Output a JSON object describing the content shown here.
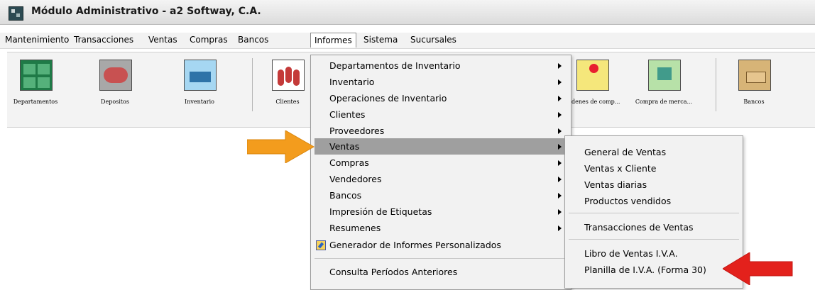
{
  "window": {
    "title": "Módulo Administrativo - a2 Softway, C.A."
  },
  "menubar": {
    "items": [
      "Mantenimiento",
      "Transacciones",
      "Ventas",
      "Compras",
      "Bancos",
      "Informes",
      "Sistema",
      "Sucursales"
    ],
    "active": "Informes"
  },
  "toolbar": {
    "buttons": [
      {
        "label": "Departamentos",
        "icon": "departments-icon"
      },
      {
        "label": "Depositos",
        "icon": "warehouse-icon"
      },
      {
        "label": "Inventario",
        "icon": "inventory-icon"
      },
      {
        "label": "Clientes",
        "icon": "clients-icon"
      },
      {
        "label": "Ordenes de comp...",
        "icon": "purchase-orders-icon"
      },
      {
        "label": "Compra de merca...",
        "icon": "merchandise-purchase-icon"
      },
      {
        "label": "Bancos",
        "icon": "banks-icon"
      }
    ]
  },
  "informes_menu": {
    "items": [
      "Departamentos de Inventario",
      "Inventario",
      "Operaciones de Inventario",
      "Clientes",
      "Proveedores",
      "Ventas",
      "Compras",
      "Vendedores",
      "Bancos",
      "Impresión de Etiquetas",
      "Resumenes",
      "Generador de Informes Personalizados",
      "Consulta Períodos Anteriores"
    ],
    "highlighted": "Ventas"
  },
  "ventas_submenu": {
    "items": [
      "General de Ventas",
      "Ventas x Cliente",
      "Ventas diarias",
      "Productos vendidos",
      "Transacciones de Ventas",
      "Libro de Ventas I.V.A.",
      "Planilla de I.V.A. (Forma 30)"
    ]
  },
  "annotations": {
    "orange_arrow_color": "#f39c1d",
    "red_arrow_color": "#e3211c"
  }
}
